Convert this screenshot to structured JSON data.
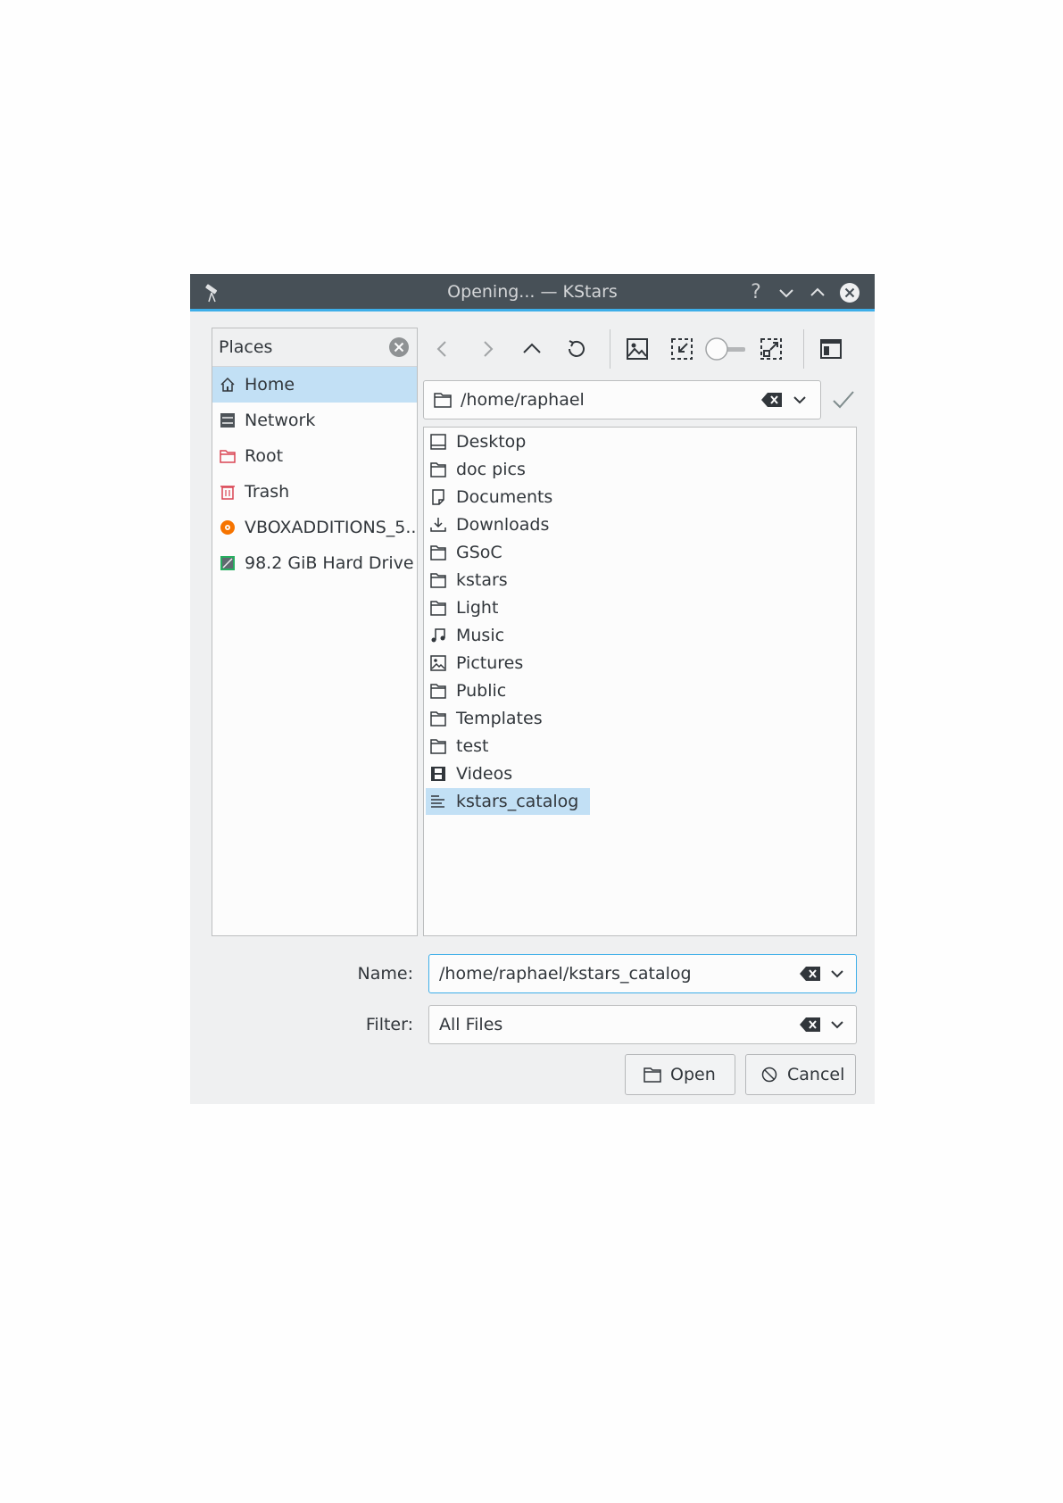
{
  "window": {
    "title": "Opening... — KStars",
    "help_glyph": "?"
  },
  "places": {
    "title": "Places",
    "items": [
      {
        "label": "Home",
        "icon": "home-icon",
        "active": true
      },
      {
        "label": "Network",
        "icon": "network-icon"
      },
      {
        "label": "Root",
        "icon": "root-folder-icon"
      },
      {
        "label": "Trash",
        "icon": "trash-icon"
      },
      {
        "label": "VBOXADDITIONS_5...",
        "icon": "optical-disc-icon"
      },
      {
        "label": "98.2 GiB Hard Drive",
        "icon": "hard-drive-icon"
      }
    ]
  },
  "location": {
    "path": "/home/raphael"
  },
  "files": [
    {
      "name": "Desktop",
      "icon": "desktop-icon"
    },
    {
      "name": "doc pics",
      "icon": "folder-icon"
    },
    {
      "name": "Documents",
      "icon": "document-icon"
    },
    {
      "name": "Downloads",
      "icon": "download-icon"
    },
    {
      "name": "GSoC",
      "icon": "folder-icon"
    },
    {
      "name": "kstars",
      "icon": "folder-icon"
    },
    {
      "name": "Light",
      "icon": "folder-icon"
    },
    {
      "name": "Music",
      "icon": "music-icon"
    },
    {
      "name": "Pictures",
      "icon": "picture-icon"
    },
    {
      "name": "Public",
      "icon": "folder-icon"
    },
    {
      "name": "Templates",
      "icon": "folder-icon"
    },
    {
      "name": "test",
      "icon": "folder-icon"
    },
    {
      "name": "Videos",
      "icon": "video-icon"
    },
    {
      "name": "kstars_catalog",
      "icon": "text-file-icon",
      "selected": true
    }
  ],
  "form": {
    "name_label": "Name:",
    "name_value": "/home/raphael/kstars_catalog",
    "filter_label": "Filter:",
    "filter_value": "All Files"
  },
  "buttons": {
    "open": "Open",
    "cancel": "Cancel"
  },
  "colors": {
    "accent": "#3daee9",
    "selection": "#c2e0f5",
    "titlebar": "#475057"
  }
}
